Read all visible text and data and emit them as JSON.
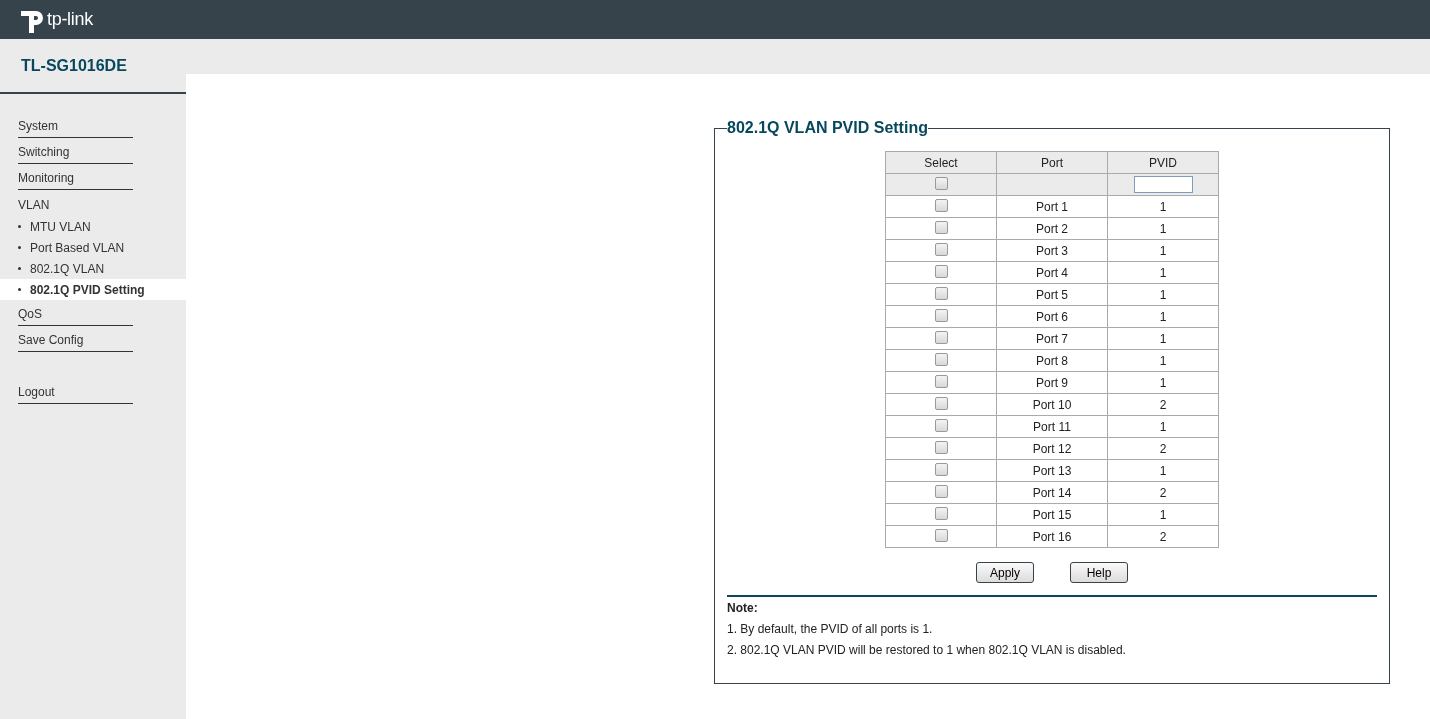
{
  "header": {
    "logo_text": "tp-link"
  },
  "model": "TL-SG1016DE",
  "sidebar": {
    "items": [
      {
        "label": "System",
        "kind": "menu",
        "selected": false
      },
      {
        "label": "Switching",
        "kind": "menu",
        "selected": false
      },
      {
        "label": "Monitoring",
        "kind": "menu",
        "selected": false
      },
      {
        "label": "VLAN",
        "kind": "group",
        "selected": false
      },
      {
        "label": "MTU VLAN",
        "kind": "sub",
        "selected": false
      },
      {
        "label": "Port Based VLAN",
        "kind": "sub",
        "selected": false
      },
      {
        "label": "802.1Q VLAN",
        "kind": "sub",
        "selected": false
      },
      {
        "label": "802.1Q PVID Setting",
        "kind": "sub",
        "selected": true
      },
      {
        "label": "QoS",
        "kind": "menu",
        "selected": false
      },
      {
        "label": "Save Config",
        "kind": "menu",
        "selected": false
      }
    ],
    "logout": "Logout"
  },
  "panel": {
    "title": "802.1Q VLAN PVID Setting",
    "table": {
      "columns": [
        "Select",
        "Port",
        "PVID"
      ],
      "select_all": {
        "checked": false
      },
      "rows": [
        {
          "checked": false,
          "port": "Port 1",
          "pvid": "1"
        },
        {
          "checked": false,
          "port": "Port 2",
          "pvid": "1"
        },
        {
          "checked": false,
          "port": "Port 3",
          "pvid": "1"
        },
        {
          "checked": false,
          "port": "Port 4",
          "pvid": "1"
        },
        {
          "checked": false,
          "port": "Port 5",
          "pvid": "1"
        },
        {
          "checked": false,
          "port": "Port 6",
          "pvid": "1"
        },
        {
          "checked": false,
          "port": "Port 7",
          "pvid": "1"
        },
        {
          "checked": false,
          "port": "Port 8",
          "pvid": "1"
        },
        {
          "checked": false,
          "port": "Port 9",
          "pvid": "1"
        },
        {
          "checked": false,
          "port": "Port 10",
          "pvid": "2"
        },
        {
          "checked": false,
          "port": "Port 11",
          "pvid": "1"
        },
        {
          "checked": false,
          "port": "Port 12",
          "pvid": "2"
        },
        {
          "checked": false,
          "port": "Port 13",
          "pvid": "1"
        },
        {
          "checked": false,
          "port": "Port 14",
          "pvid": "2"
        },
        {
          "checked": false,
          "port": "Port 15",
          "pvid": "1"
        },
        {
          "checked": false,
          "port": "Port 16",
          "pvid": "2"
        }
      ]
    },
    "buttons": [
      "Apply",
      "Help"
    ],
    "note": {
      "title": "Note:",
      "lines": [
        "1. By default, the PVID of all ports is 1.",
        "2. 802.1Q VLAN PVID will be restored to 1 when 802.1Q VLAN is disabled."
      ]
    }
  }
}
